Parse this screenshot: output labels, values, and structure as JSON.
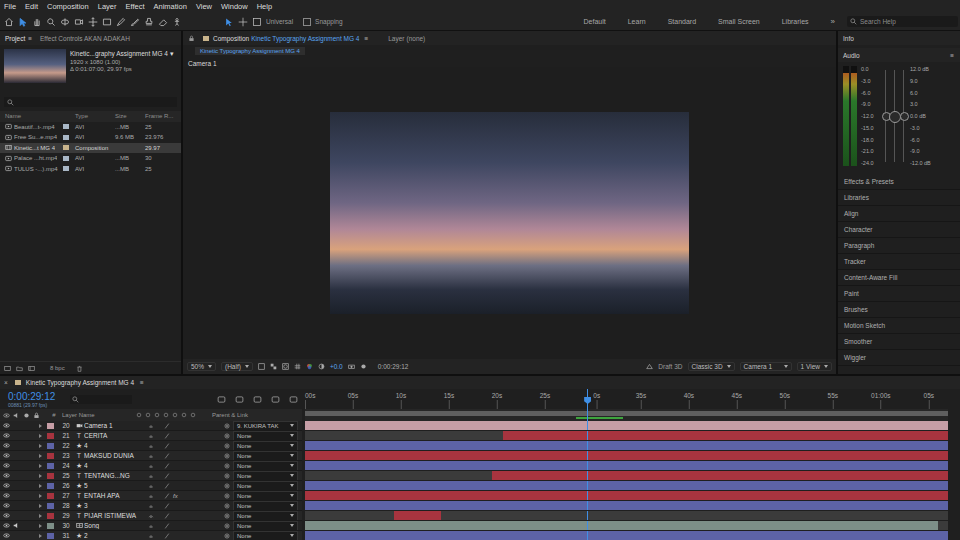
{
  "menu": [
    "File",
    "Edit",
    "Composition",
    "Layer",
    "Effect",
    "Animation",
    "View",
    "Window",
    "Help"
  ],
  "toolbar": {
    "tools": [
      {
        "selected": false
      },
      {
        "selected": true
      },
      {
        "selected": false
      },
      {
        "selected": false
      },
      {
        "selected": false
      },
      {
        "selected": false
      },
      {
        "selected": false
      },
      {
        "selected": false
      },
      {
        "selected": false
      },
      {
        "selected": false
      },
      {
        "selected": false
      },
      {
        "selected": false
      },
      {
        "selected": false
      }
    ],
    "snap_mode": "Universal",
    "snapping": {
      "label": "Snapping",
      "checked": false
    },
    "workspaces": [
      {
        "label": "Default",
        "selected": false
      },
      {
        "label": "Learn",
        "selected": false
      },
      {
        "label": "Standard",
        "selected": false
      },
      {
        "label": "Small Screen",
        "selected": false
      },
      {
        "label": "Libraries",
        "selected": false
      }
    ],
    "overflow": "»",
    "search": {
      "placeholder": "Search Help"
    }
  },
  "project": {
    "tabs": [
      {
        "label": "Project",
        "selected": true
      },
      {
        "label": "Effect Controls AKAN ADAKAH",
        "selected": false
      }
    ],
    "menu": "≡",
    "preview": {
      "name": "Kinetic...graphy Assignment MG 4",
      "dropdown": "▾",
      "size": "1920 x 1080 (1.00)",
      "duration": "Δ 0:01:07:00, 29.97 fps"
    },
    "columns": [
      "Name",
      "Type",
      "Size",
      "Frame R..."
    ],
    "items": [
      {
        "name": "Beautif...t-.mp4",
        "kind": "video",
        "type": "AVI",
        "size": "...MB",
        "fps": "25",
        "color": "#a9b7c6",
        "selected": false
      },
      {
        "name": "Free Su...e.mp4",
        "kind": "video",
        "type": "AVI",
        "size": "9.6 MB",
        "fps": "23.976",
        "color": "#a9b7c6",
        "selected": false
      },
      {
        "name": "Kinetic...t MG 4",
        "kind": "composition",
        "type": "Composition",
        "size": "",
        "fps": "29.97",
        "color": "#c9b48c",
        "selected": true
      },
      {
        "name": "Palace ...ht.mp4",
        "kind": "video",
        "type": "AVI",
        "size": "...MB",
        "fps": "30",
        "color": "#a9b7c6",
        "selected": false
      },
      {
        "name": "TULUS -...).mp4",
        "kind": "video",
        "type": "AVI",
        "size": "...MB",
        "fps": "25",
        "color": "#a9b7c6",
        "selected": false
      }
    ],
    "bit_depth": "8 bpc"
  },
  "viewer": {
    "tabs": [
      {
        "prefix": "Composition",
        "label": "Kinetic Typography Assignment MG 4",
        "selected": true
      },
      {
        "prefix": "Layer",
        "label": "(none)",
        "selected": false
      }
    ],
    "menu": "≡",
    "subtab": "Kinetic Typography Assignment MG 4",
    "view_label": "Camera 1",
    "footer": {
      "zoom": "50%",
      "resolution": "(Half)",
      "exposure": "+0.0",
      "time": "0:00:29:12",
      "draft": "Draft 3D",
      "renderer": "Classic 3D",
      "camera": "Camera 1",
      "views": "1 View"
    }
  },
  "right": {
    "info": "Info",
    "audio": {
      "title": "Audio",
      "menu": "≡",
      "channels": [
        {
          "level": 0.93
        },
        {
          "level": 0.93
        }
      ],
      "left_scale": [
        "0.0",
        "-3.0",
        "-6.0",
        "-9.0",
        "-12.0",
        "-15.0",
        "-18.0",
        "-21.0",
        "-24.0"
      ],
      "right_scale": [
        "12.0 dB",
        "9.0",
        "6.0",
        "3.0",
        "0.0 dB",
        "-3.0",
        "-6.0",
        "-9.0",
        "-12.0 dB"
      ],
      "sliders": [
        {
          "level": 0.5
        },
        {
          "level": 0.5
        },
        {
          "level": 0.5
        }
      ]
    },
    "panels": [
      "Effects & Presets",
      "Libraries",
      "Align",
      "Character",
      "Paragraph",
      "Tracker",
      "Content-Aware Fill",
      "Paint",
      "Brushes",
      "Motion Sketch",
      "Smoother",
      "Wiggler"
    ]
  },
  "timeline": {
    "tab": {
      "close": "×",
      "label": "Kinetic Typography Assignment MG 4",
      "menu": "≡",
      "color": "#c9b48c"
    },
    "timecode": "0:00:29:12",
    "frame_info": "00881 (29.97 fps)",
    "duration": 67,
    "playhead": 29.4,
    "work_area": {
      "start": 0,
      "end": 67
    },
    "cache": {
      "start": 28.2,
      "end": 33.1
    },
    "ticks": [
      {
        "label": "00s",
        "t": 0
      },
      {
        "label": "05s",
        "t": 5
      },
      {
        "label": "10s",
        "t": 10
      },
      {
        "label": "15s",
        "t": 15
      },
      {
        "label": "20s",
        "t": 20
      },
      {
        "label": "25s",
        "t": 25
      },
      {
        "label": "0s",
        "t": 30.4
      },
      {
        "label": "35s",
        "t": 35
      },
      {
        "label": "40s",
        "t": 40
      },
      {
        "label": "45s",
        "t": 45
      },
      {
        "label": "50s",
        "t": 50
      },
      {
        "label": "55s",
        "t": 55
      },
      {
        "label": "01:00s",
        "t": 60
      },
      {
        "label": "05s",
        "t": 65
      }
    ],
    "columns": {
      "number": "#",
      "name": "Layer Name",
      "parent": "Parent & Link"
    },
    "fx_label": "fx",
    "layers": [
      {
        "number": "20",
        "kind": "camera",
        "name": "Camera 1",
        "parent": "9. KUKIRA TAK",
        "color": "#c69ea6",
        "fx": false,
        "visible": true,
        "audio": false,
        "start": 0,
        "end": 67
      },
      {
        "number": "21",
        "kind": "text",
        "glyph": "T",
        "name": "CERITA",
        "parent": "None",
        "color": "#a8343f",
        "fx": false,
        "visible": true,
        "audio": false,
        "start": 20.6,
        "end": 67
      },
      {
        "number": "22",
        "kind": "shape",
        "glyph": "★",
        "name": "4",
        "parent": "None",
        "color": "#5d63a6",
        "fx": false,
        "visible": true,
        "audio": false,
        "start": 0,
        "end": 67
      },
      {
        "number": "23",
        "kind": "text",
        "glyph": "T",
        "name": "MAKSUD DUNIA",
        "parent": "None",
        "color": "#a8343f",
        "fx": false,
        "visible": true,
        "audio": false,
        "start": 0,
        "end": 67
      },
      {
        "number": "24",
        "kind": "shape",
        "glyph": "★",
        "name": "4",
        "parent": "None",
        "color": "#5d63a6",
        "fx": false,
        "visible": true,
        "audio": false,
        "start": 0,
        "end": 67
      },
      {
        "number": "25",
        "kind": "text",
        "glyph": "T",
        "name": "TENTANG...NG",
        "parent": "None",
        "color": "#a8343f",
        "fx": false,
        "visible": true,
        "audio": false,
        "start": 19.5,
        "end": 67
      },
      {
        "number": "26",
        "kind": "shape",
        "glyph": "★",
        "name": "5",
        "parent": "None",
        "color": "#5d63a6",
        "fx": false,
        "visible": true,
        "audio": false,
        "start": 0,
        "end": 67
      },
      {
        "number": "27",
        "kind": "text",
        "glyph": "T",
        "name": "ENTAH APA",
        "parent": "None",
        "color": "#a8343f",
        "fx": true,
        "visible": true,
        "audio": false,
        "start": 0,
        "end": 67
      },
      {
        "number": "28",
        "kind": "shape",
        "glyph": "★",
        "name": "3",
        "parent": "None",
        "color": "#5d63a6",
        "fx": false,
        "visible": true,
        "audio": false,
        "start": 0,
        "end": 67
      },
      {
        "number": "29",
        "kind": "text",
        "glyph": "T",
        "name": "PIJAR ISTIMEWA",
        "parent": "None",
        "color": "#a8343f",
        "fx": false,
        "visible": true,
        "audio": false,
        "start": 9.3,
        "end": 14.2
      },
      {
        "number": "30",
        "kind": "audio",
        "name": "Song",
        "parent": "None",
        "color": "#7d8f88",
        "fx": false,
        "visible": true,
        "audio": true,
        "start": 0,
        "end": 66
      },
      {
        "number": "31",
        "kind": "shape",
        "glyph": "★",
        "name": "2",
        "parent": "None",
        "color": "#5d63a6",
        "fx": false,
        "visible": true,
        "audio": false,
        "start": 0,
        "end": 67
      }
    ]
  }
}
